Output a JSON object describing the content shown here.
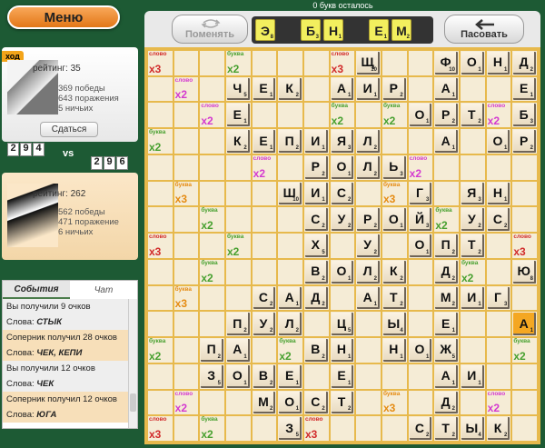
{
  "menu_label": "Меню",
  "letters_left": "0 букв осталось",
  "player1": {
    "turn_label": "ход",
    "name": "",
    "rating": "рейтинг: 35",
    "wins": "369 победы",
    "losses": "643 поражения",
    "draws": "5 ничьих",
    "giveup_label": "Сдаться",
    "score": [
      "2",
      "9",
      "4"
    ]
  },
  "vs_label": "vs",
  "player2": {
    "name": "",
    "rating": "рейтинг: 262",
    "wins": "562 победы",
    "losses": "471 поражение",
    "draws": "6 ничьих",
    "score": [
      "2",
      "9",
      "6"
    ]
  },
  "tabs": {
    "events": "События",
    "chat": "Чат"
  },
  "log": [
    {
      "type": "mine",
      "text": "Вы получили 9 очков"
    },
    {
      "type": "mine",
      "prefix": "Слова: ",
      "words": "СТЫК"
    },
    {
      "type": "opp",
      "text": "Соперник получил 28 очков"
    },
    {
      "type": "opp",
      "prefix": "Слова: ",
      "words": "ЧЕК, КЕПИ"
    },
    {
      "type": "mine",
      "text": "Вы получили 12 очков"
    },
    {
      "type": "mine",
      "prefix": "Слова: ",
      "words": "ЧЕК"
    },
    {
      "type": "opp",
      "text": "Соперник получил 12 очков"
    },
    {
      "type": "opp",
      "prefix": "Слова: ",
      "words": "ЮГА"
    }
  ],
  "swap_label": "Поменять",
  "pass_label": "Пасовать",
  "rack": [
    {
      "l": "Э",
      "p": "8"
    },
    {
      "l": "",
      "p": ""
    },
    {
      "l": "Б",
      "p": "3"
    },
    {
      "l": "Н",
      "p": "1"
    },
    {
      "l": "",
      "p": ""
    },
    {
      "l": "Е",
      "p": "1"
    },
    {
      "l": "М",
      "p": "2"
    }
  ],
  "bonus_labels": {
    "w3": {
      "label": "слово",
      "mult": "x3"
    },
    "w2": {
      "label": "слово",
      "mult": "x2"
    },
    "l3": {
      "label": "буква",
      "mult": "x3"
    },
    "l2": {
      "label": "буква",
      "mult": "x2"
    }
  },
  "board_rows": [
    "W3 . . L2 . . . W3 Щ10 . . Ф10 О1 Н1 Д2",
    ". W2 . Ч5 Е1 К2 . А1 И1 Р2 . А1 . . Е1",
    ". . W2 Е1 . . . L2 . L2 О1 Р2 Т2 W2 Б3",
    "L2 . . К2 Е1 П2 И1 Я3 Л2 . . А1 . О1 Р2",
    ". . . . W2 . Р2 О1 Л2 Ь3 W2 . . . .",
    ". L3 . . . Ш10 И1 С2 . L3 Г3 . Я3 Н1 .",
    ". . L2 . . . С2 У2 Р2 О1 Й3 L2 У2 С2 .",
    "W3 . . L2 . . Х5 . У2 . О1 П2 Т2 . W3",
    ". . L2 . . . В2 О1 Л2 К2 . Д2 L2 . Ю8",
    ". L3 . . С2 А1 Д2 . А1 Т2 . М2 И1 Г3 .",
    ". . . П2 У2 Л2 . Ц5 . Ы4 . Е1 . . *А1",
    "L2 . П2 А1 . L2 В2 Н1 . Н1 О1 Ж5 . . L2",
    ". . З5 О1 В2 Е1 . Е1 . . . А1 И1 . .",
    ". W2 . . М2 О1 С2 Т2 . L3 . Д2 . W2 .",
    "W3 . L2 . . З5 W3 . . . С2 Т2 Ы4 К2 ."
  ]
}
